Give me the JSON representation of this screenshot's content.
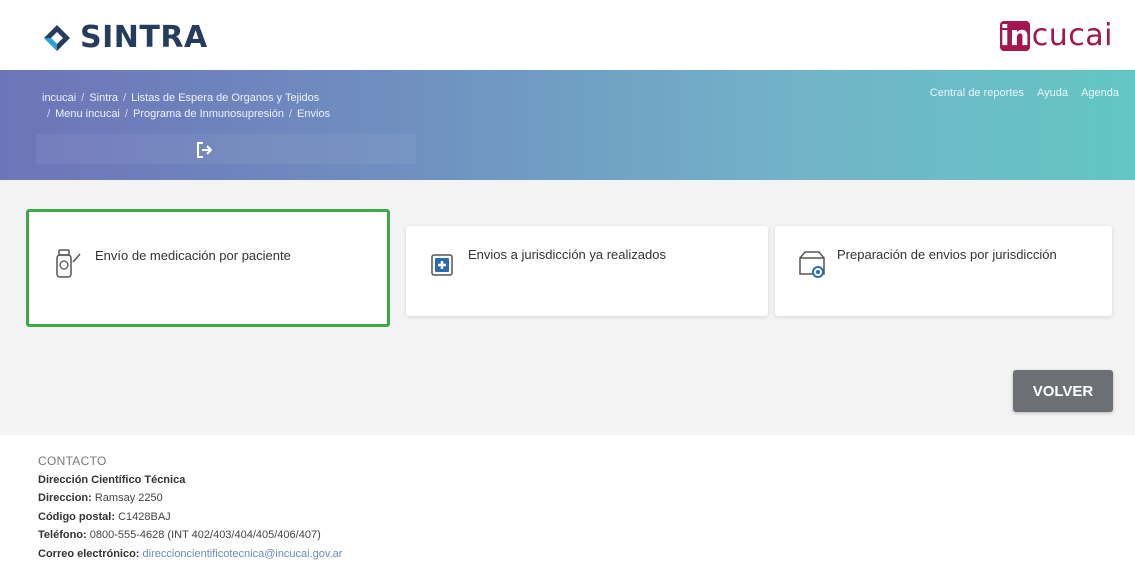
{
  "brand": {
    "name": "SINTRA",
    "partner_initial": "in",
    "partner_rest": "cucai"
  },
  "header": {
    "breadcrumb": [
      "incucai",
      "Sintra",
      "Listas de Espera de Organos y Tejidos",
      "Menu incucai",
      "Programa de Inmunosupresión",
      "Envios"
    ],
    "links": [
      "Central de reportes",
      "Ayuda",
      "Agenda"
    ]
  },
  "cards": [
    {
      "label": "Envío de medicación por paciente",
      "icon": "medication-bottle-icon"
    },
    {
      "label": "Envios a jurisdicción ya realizados",
      "icon": "medical-cross-icon"
    },
    {
      "label": "Preparación de envios por jurisdicción",
      "icon": "package-icon"
    }
  ],
  "actions": {
    "back_label": "VOLVER"
  },
  "footer": {
    "title": "CONTACTO",
    "org": "Dirección Científico Técnica",
    "address_label": "Direccion:",
    "address": "Ramsay 2250",
    "postal_label": "Código postal:",
    "postal": "C1428BAJ",
    "phone_label": "Teléfono:",
    "phone": "0800-555-4628 (INT 402/403/404/405/406/407)",
    "email_label": "Correo electrónico:",
    "email": "direccioncientificotecnica@incucai.gov.ar"
  },
  "colors": {
    "selected_border": "#3fa84a",
    "brand_dark": "#263c5c",
    "incucai": "#a3164f",
    "button": "#6c7075"
  }
}
